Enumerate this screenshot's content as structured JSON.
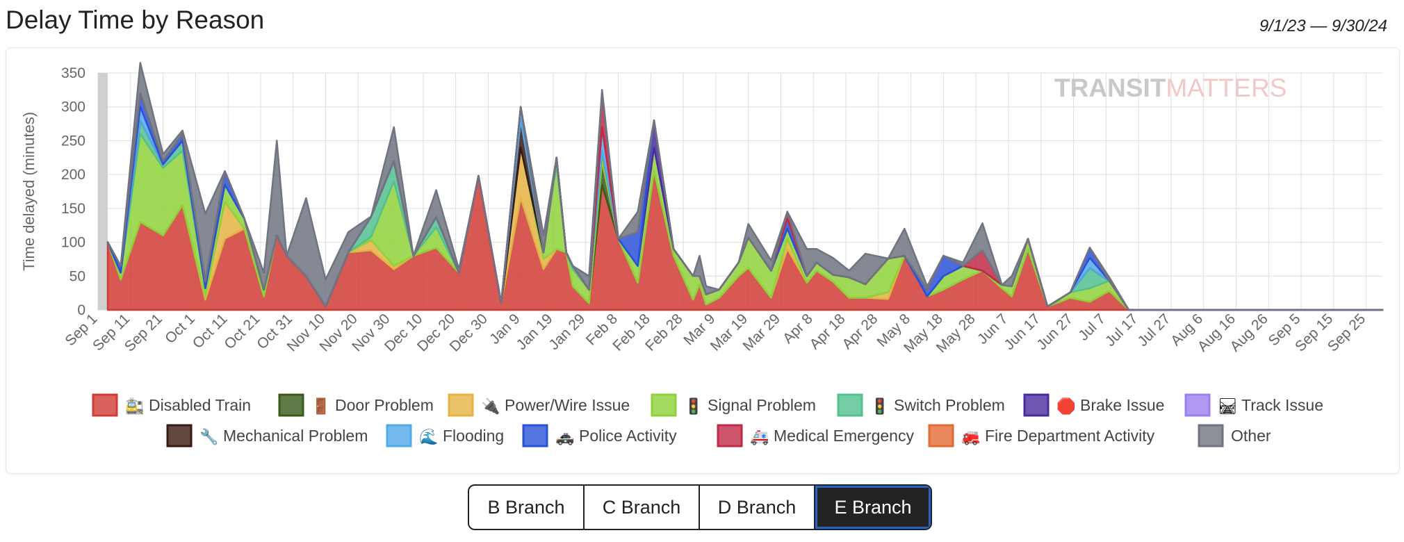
{
  "header": {
    "title": "Delay Time by Reason",
    "date_range": "9/1/23 — 9/30/24"
  },
  "watermark": {
    "part1": "TRANSIT",
    "part2": "MATTERS"
  },
  "colors": {
    "grid": "#dedede",
    "axis_text": "#666666",
    "active_button": "#232323",
    "active_outline": "#2a63c8"
  },
  "chart_data": {
    "type": "area",
    "stacked": true,
    "xlabel": "",
    "ylabel": "Time delayed (minutes)",
    "ylim": [
      0,
      350
    ],
    "yticks": [
      0,
      50,
      100,
      150,
      200,
      250,
      300,
      350
    ],
    "x_start": "Sep 1",
    "x_end_day_index": 395,
    "xtick_days": [
      0,
      10,
      20,
      30,
      40,
      50,
      60,
      70,
      80,
      90,
      100,
      110,
      120,
      130,
      140,
      150,
      160,
      170,
      180,
      190,
      200,
      210,
      220,
      230,
      240,
      250,
      260,
      270,
      280,
      290,
      300,
      310,
      320,
      330,
      340,
      350,
      360,
      370,
      380,
      390
    ],
    "xtick_labels": [
      "Sep 1",
      "Sep 11",
      "Sep 21",
      "Oct 1",
      "Oct 11",
      "Oct 21",
      "Oct 31",
      "Nov 10",
      "Nov 20",
      "Nov 30",
      "Dec 10",
      "Dec 20",
      "Dec 30",
      "Jan 9",
      "Jan 19",
      "Jan 29",
      "Feb 8",
      "Feb 18",
      "Feb 28",
      "Mar 9",
      "Mar 19",
      "Mar 29",
      "Apr 8",
      "Apr 18",
      "Apr 28",
      "May 8",
      "May 18",
      "May 28",
      "Jun 7",
      "Jun 17",
      "Jun 27",
      "Jul 7",
      "Jul 17",
      "Jul 27",
      "Aug 6",
      "Aug 16",
      "Aug 26",
      "Sep 5",
      "Sep 15",
      "Sep 25"
    ],
    "grid": true,
    "legend_position": "bottom",
    "x_days": [
      3,
      7,
      13,
      20,
      26,
      33,
      39,
      45,
      51,
      55,
      58,
      64,
      70,
      77,
      84,
      91,
      97,
      104,
      111,
      117,
      124,
      130,
      137,
      141,
      144,
      146,
      151,
      155,
      160,
      166,
      171,
      177,
      183,
      185,
      187,
      191,
      197,
      200,
      207,
      212,
      218,
      221,
      226,
      231,
      236,
      243,
      248,
      255,
      260,
      266,
      272,
      278,
      281,
      286,
      292,
      299,
      305,
      311,
      317,
      323,
      327,
      331,
      337,
      343,
      349,
      355,
      361,
      366,
      373,
      376,
      380,
      386,
      391,
      395
    ],
    "series": [
      {
        "name": "Disabled Train",
        "icon": "🚉",
        "color": "#d13b35",
        "values": [
          100,
          45,
          130,
          110,
          155,
          15,
          105,
          120,
          20,
          110,
          80,
          50,
          5,
          85,
          88,
          60,
          80,
          92,
          55,
          198,
          10,
          165,
          60,
          90,
          85,
          35,
          10,
          185,
          105,
          40,
          205,
          80,
          15,
          38,
          8,
          18,
          50,
          62,
          18,
          90,
          40,
          58,
          42,
          18,
          18,
          16,
          80,
          20,
          30,
          45,
          58,
          32,
          20,
          90,
          5,
          18,
          12,
          28
        ]
      },
      {
        "name": "Door Problem",
        "icon": "🚪",
        "color": "#3a5a1a",
        "values": [
          0,
          0,
          0,
          0,
          0,
          0,
          0,
          0,
          0,
          0,
          0,
          0,
          0,
          0,
          0,
          0,
          0,
          0,
          0,
          0,
          0,
          0,
          0,
          0,
          0,
          0,
          0,
          35,
          0,
          0,
          0,
          0,
          0,
          0,
          0,
          0,
          0,
          0,
          0,
          0,
          0,
          0,
          0,
          0,
          0,
          0,
          0,
          0,
          0,
          0,
          0,
          0,
          0,
          0,
          0,
          0,
          0,
          0
        ]
      },
      {
        "name": "Power/Wire Issue",
        "icon": "🔌",
        "color": "#e4b343",
        "values": [
          0,
          0,
          0,
          0,
          0,
          5,
          55,
          0,
          0,
          0,
          0,
          0,
          0,
          0,
          15,
          5,
          0,
          0,
          0,
          0,
          0,
          75,
          15,
          0,
          0,
          0,
          0,
          0,
          0,
          0,
          0,
          0,
          0,
          0,
          0,
          0,
          0,
          0,
          0,
          15,
          0,
          0,
          0,
          0,
          0,
          10,
          0,
          0,
          0,
          0,
          0,
          0,
          0,
          0,
          0,
          0,
          0,
          0
        ]
      },
      {
        "name": "Signal Problem",
        "icon": "🚦",
        "color": "#8fd13a",
        "values": [
          0,
          10,
          130,
          100,
          80,
          12,
          25,
          15,
          10,
          0,
          0,
          0,
          0,
          0,
          5,
          125,
          0,
          30,
          0,
          0,
          0,
          0,
          10,
          125,
          0,
          25,
          20,
          15,
          0,
          25,
          35,
          10,
          35,
          12,
          15,
          12,
          20,
          45,
          40,
          15,
          10,
          12,
          10,
          30,
          20,
          50,
          0,
          0,
          20,
          20,
          0,
          5,
          15,
          15,
          0,
          8,
          20,
          15
        ]
      },
      {
        "name": "Switch Problem",
        "icon": "🚦",
        "color": "#52c08f",
        "values": [
          0,
          0,
          20,
          5,
          15,
          0,
          0,
          0,
          0,
          0,
          0,
          0,
          0,
          0,
          30,
          30,
          0,
          15,
          0,
          0,
          0,
          0,
          0,
          10,
          0,
          5,
          0,
          0,
          0,
          0,
          0,
          0,
          0,
          0,
          0,
          0,
          0,
          0,
          0,
          0,
          0,
          0,
          0,
          0,
          0,
          0,
          0,
          0,
          0,
          0,
          0,
          0,
          0,
          0,
          0,
          0,
          30,
          0
        ]
      },
      {
        "name": "Brake Issue",
        "icon": "🛑",
        "color": "#4b2c9e",
        "values": [
          0,
          0,
          0,
          0,
          0,
          0,
          0,
          0,
          0,
          0,
          0,
          0,
          0,
          0,
          0,
          0,
          0,
          0,
          0,
          0,
          0,
          0,
          0,
          0,
          0,
          0,
          0,
          0,
          0,
          0,
          40,
          0,
          0,
          0,
          0,
          0,
          0,
          0,
          0,
          0,
          0,
          0,
          0,
          0,
          0,
          0,
          0,
          0,
          0,
          0,
          0,
          0,
          0,
          0,
          0,
          0,
          0,
          0
        ]
      },
      {
        "name": "Track Issue",
        "icon": "🛤",
        "color": "#9b7ff0",
        "values": [
          0,
          0,
          0,
          0,
          0,
          0,
          0,
          0,
          0,
          0,
          0,
          0,
          0,
          0,
          0,
          0,
          0,
          0,
          0,
          0,
          0,
          0,
          0,
          0,
          0,
          0,
          0,
          0,
          0,
          0,
          0,
          0,
          0,
          0,
          0,
          0,
          0,
          0,
          0,
          0,
          0,
          0,
          0,
          0,
          0,
          0,
          0,
          0,
          0,
          0,
          0,
          0,
          0,
          0,
          0,
          0,
          0,
          0
        ]
      },
      {
        "name": "Mechanical Problem",
        "icon": "🔧",
        "color": "#3a1a10",
        "values": [
          0,
          0,
          0,
          0,
          0,
          0,
          0,
          0,
          0,
          0,
          0,
          0,
          0,
          0,
          0,
          0,
          0,
          0,
          0,
          0,
          0,
          40,
          0,
          0,
          0,
          0,
          0,
          0,
          0,
          0,
          0,
          0,
          0,
          0,
          0,
          0,
          0,
          0,
          0,
          0,
          0,
          0,
          0,
          0,
          0,
          0,
          0,
          0,
          0,
          0,
          0,
          0,
          0,
          0,
          0,
          0,
          0,
          0
        ]
      },
      {
        "name": "Flooding",
        "icon": "🌊",
        "color": "#52a9ea",
        "values": [
          0,
          0,
          20,
          0,
          0,
          0,
          0,
          0,
          0,
          0,
          0,
          0,
          0,
          0,
          0,
          0,
          0,
          0,
          0,
          0,
          0,
          20,
          0,
          0,
          0,
          0,
          0,
          35,
          0,
          0,
          0,
          0,
          0,
          0,
          0,
          0,
          0,
          0,
          0,
          0,
          0,
          0,
          0,
          0,
          0,
          0,
          0,
          0,
          0,
          0,
          0,
          0,
          0,
          0,
          0,
          0,
          15,
          0
        ]
      },
      {
        "name": "Police Activity",
        "icon": "🚓",
        "color": "#2a52d8",
        "values": [
          0,
          10,
          20,
          5,
          10,
          10,
          20,
          0,
          0,
          0,
          0,
          0,
          0,
          0,
          0,
          0,
          0,
          0,
          0,
          0,
          0,
          0,
          0,
          0,
          0,
          0,
          0,
          0,
          0,
          50,
          0,
          0,
          0,
          0,
          0,
          0,
          0,
          0,
          0,
          15,
          0,
          0,
          0,
          0,
          0,
          0,
          0,
          10,
          30,
          0,
          0,
          0,
          0,
          0,
          0,
          0,
          15,
          0
        ]
      },
      {
        "name": "Medical Emergency",
        "icon": "🚑",
        "color": "#c02a48",
        "values": [
          0,
          0,
          0,
          0,
          0,
          0,
          0,
          0,
          0,
          0,
          0,
          0,
          0,
          0,
          0,
          0,
          0,
          0,
          0,
          0,
          0,
          0,
          0,
          0,
          0,
          0,
          0,
          50,
          0,
          0,
          0,
          0,
          0,
          0,
          0,
          0,
          0,
          0,
          0,
          10,
          0,
          0,
          0,
          0,
          0,
          0,
          0,
          0,
          0,
          0,
          30,
          0,
          0,
          0,
          0,
          0,
          0,
          0
        ]
      },
      {
        "name": "Fire Department Activity",
        "icon": "🚒",
        "color": "#e36a33",
        "values": [
          0,
          0,
          0,
          0,
          0,
          0,
          0,
          0,
          0,
          0,
          0,
          0,
          0,
          0,
          0,
          0,
          0,
          0,
          0,
          0,
          0,
          0,
          0,
          0,
          0,
          0,
          0,
          0,
          0,
          0,
          0,
          0,
          0,
          0,
          0,
          0,
          0,
          0,
          0,
          0,
          0,
          0,
          0,
          0,
          0,
          0,
          0,
          0,
          0,
          0,
          0,
          0,
          0,
          0,
          0,
          0,
          0,
          0
        ]
      },
      {
        "name": "Other",
        "icon": "",
        "color": "#6f7480",
        "values": [
          0,
          0,
          45,
          10,
          5,
          100,
          0,
          0,
          25,
          140,
          0,
          115,
          40,
          30,
          0,
          50,
          0,
          40,
          5,
          0,
          0,
          0,
          25,
          0,
          0,
          0,
          20,
          5,
          0,
          30,
          0,
          0,
          0,
          30,
          12,
          0,
          0,
          20,
          15,
          0,
          40,
          20,
          25,
          10,
          45,
          0,
          40,
          5,
          0,
          5,
          40,
          0,
          15,
          0,
          0,
          0,
          0,
          5
        ]
      }
    ]
  },
  "branches": {
    "options": [
      "B Branch",
      "C Branch",
      "D Branch",
      "E Branch"
    ],
    "selected": "E Branch"
  }
}
